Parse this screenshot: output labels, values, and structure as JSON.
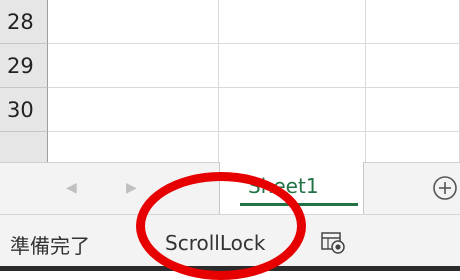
{
  "grid": {
    "rows": [
      {
        "number": "28"
      },
      {
        "number": "29"
      },
      {
        "number": "30"
      }
    ]
  },
  "tabs": {
    "prev_icon": "triangle-left",
    "next_icon": "triangle-right",
    "sheets": [
      {
        "label": "Sheet1",
        "active": true
      }
    ],
    "add_icon": "plus-circle-icon"
  },
  "status": {
    "ready": "準備完了",
    "scroll_lock": "ScrollLock",
    "macro_icon": "macro-record-icon"
  },
  "colors": {
    "accent_green": "#217346",
    "highlight_red": "#e60000"
  }
}
